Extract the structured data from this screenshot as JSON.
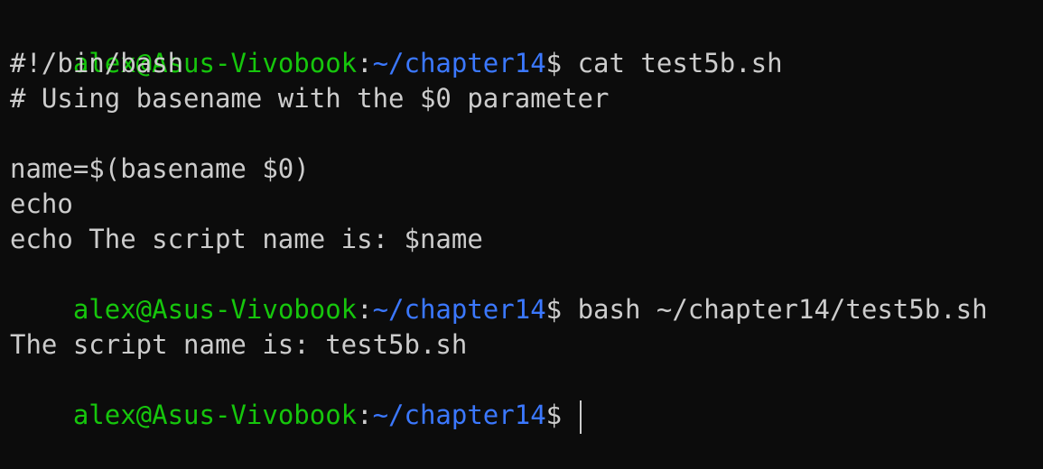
{
  "prompt": {
    "user_host": "alex@Asus-Vivobook",
    "separator": ":",
    "path": "~/chapter14",
    "symbol": "$"
  },
  "colors": {
    "background": "#0c0c0c",
    "text": "#cccccc",
    "user_host": "#16c60c",
    "path": "#3b78ff"
  },
  "lines": {
    "l1_cmd": " cat test5b.sh",
    "l2": "#!/bin/bash",
    "l3": "# Using basename with the $0 parameter",
    "l4": "",
    "l5": "name=$(basename $0)",
    "l6": "echo",
    "l7": "echo The script name is: $name",
    "l8_cmd": " bash ~/chapter14/test5b.sh",
    "l9": "",
    "l10": "The script name is: test5b.sh",
    "l11_cmd": " "
  }
}
